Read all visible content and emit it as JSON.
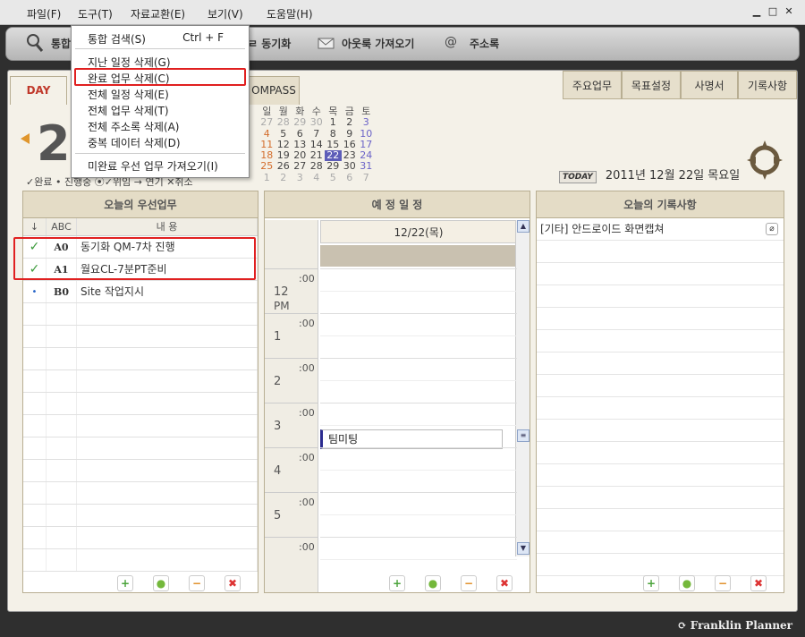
{
  "menubar": {
    "items": [
      "파일(F)",
      "도구(T)",
      "자료교환(E)",
      "보기(V)",
      "도움말(H)"
    ]
  },
  "toolbar": {
    "items": [
      "통합",
      "ㄹ 동기화",
      "아웃룩 가져오기",
      "주소록"
    ]
  },
  "tools_menu": {
    "items": [
      {
        "label": "통합 검색(S)",
        "shortcut": "Ctrl + F"
      },
      {
        "label": "지난 일정 삭제(G)"
      },
      {
        "label": "완료 업무 삭제(C)"
      },
      {
        "label": "전체 일정 삭제(E)"
      },
      {
        "label": "전체 업무 삭제(T)"
      },
      {
        "label": "전체 주소록 삭제(A)"
      },
      {
        "label": "중복 데이터 삭제(D)"
      },
      {
        "label": "미완료 우선 업무 가져오기(I)"
      }
    ]
  },
  "left_tabs": [
    "DAY",
    "OMPASS"
  ],
  "right_tabs": [
    "주요업무",
    "목표설정",
    "사명서",
    "기록사항"
  ],
  "big_date": "2",
  "legend": "✓완료 • 진행중 ⦿✓위임 → 연기 ✕취소",
  "mini_calendar": {
    "headers": [
      "일",
      "월",
      "화",
      "수",
      "목",
      "금",
      "토"
    ],
    "weeks": [
      [
        "27",
        "28",
        "29",
        "30",
        "1",
        "2",
        "3"
      ],
      [
        "4",
        "5",
        "6",
        "7",
        "8",
        "9",
        "10"
      ],
      [
        "11",
        "12",
        "13",
        "14",
        "15",
        "16",
        "17"
      ],
      [
        "18",
        "19",
        "20",
        "21",
        "22",
        "23",
        "24"
      ],
      [
        "25",
        "26",
        "27",
        "28",
        "29",
        "30",
        "31"
      ],
      [
        "1",
        "2",
        "3",
        "4",
        "5",
        "6",
        "7"
      ]
    ],
    "selected": "22"
  },
  "today": {
    "badge": "TODAY",
    "text": "2011년 12월 22일 목요일"
  },
  "priority_panel": {
    "title": "오늘의 우선업무",
    "col_order": "↓",
    "col_abc": "ABC",
    "col_content": "내 용",
    "rows": [
      {
        "status": "✓",
        "priority": "A0",
        "task": "동기화 QM-7차 진행"
      },
      {
        "status": "✓",
        "priority": "A1",
        "task": "월요CL-7분PT준비"
      },
      {
        "status": "•",
        "priority": "B0",
        "task": "Site 작업지시"
      }
    ]
  },
  "schedule_panel": {
    "title": "예 정 일 정",
    "date": "12/22(목)",
    "slots": [
      {
        "hour": "12",
        "sub": "PM",
        "min": ":00"
      },
      {
        "hour": "1",
        "sub": "",
        "min": ":00"
      },
      {
        "hour": "2",
        "sub": "",
        "min": ":00"
      },
      {
        "hour": "3",
        "sub": "",
        "min": ":00"
      },
      {
        "hour": "4",
        "sub": "",
        "min": ":00"
      },
      {
        "hour": "5",
        "sub": "",
        "min": ":00"
      },
      {
        "hour": "",
        "sub": "",
        "min": ":00"
      }
    ],
    "event": "팀미팅"
  },
  "memo_panel": {
    "title": "오늘의 기록사항",
    "rows": [
      "[기타] 안드로이드 화면캡쳐"
    ]
  },
  "brand": "Franklin Planner",
  "colors": {
    "accent_red": "#c0392b",
    "highlight_box": "#e02020",
    "selected_day": "#5d5db8"
  }
}
